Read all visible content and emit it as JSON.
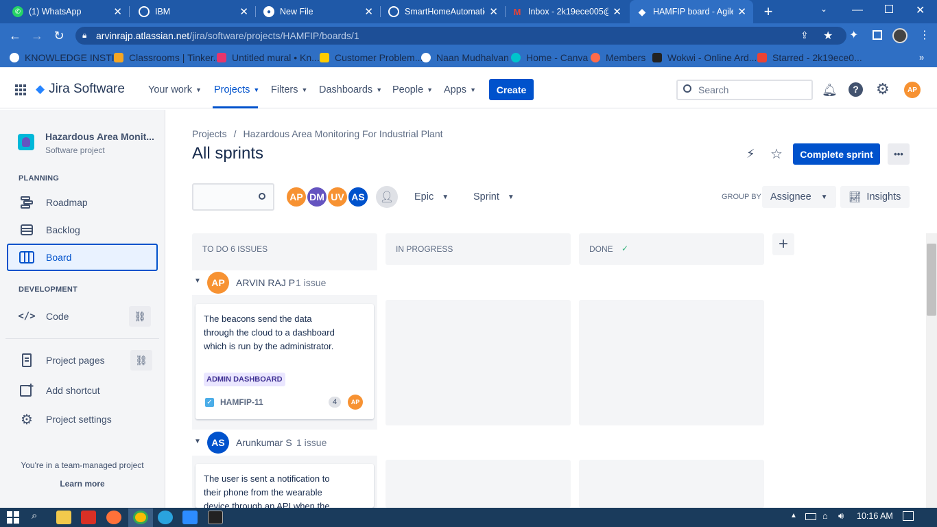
{
  "browser": {
    "tabs": [
      {
        "title": "(1) WhatsApp",
        "icon": "whatsapp-icon",
        "active": false
      },
      {
        "title": "IBM",
        "icon": "globe-icon",
        "active": false
      },
      {
        "title": "New File",
        "icon": "github-icon",
        "active": false
      },
      {
        "title": "SmartHomeAutomatic",
        "icon": "globe-icon",
        "active": false
      },
      {
        "title": "Inbox - 2k19ece005@",
        "icon": "gmail-icon",
        "active": false
      },
      {
        "title": "HAMFIP board - Agile",
        "icon": "jira-icon",
        "active": true
      }
    ],
    "new_tab": "+",
    "url_host": "arvinrajp.atlassian.net",
    "url_path": "/jira/software/projects/HAMFIP/boards/1",
    "bookmarks": [
      {
        "label": "KNOWLEDGE INSTI...",
        "color": "#ffffff"
      },
      {
        "label": "Classrooms | Tinker...",
        "color": "#f5a623"
      },
      {
        "label": "Untitled mural • Kn...",
        "color": "#e8356c"
      },
      {
        "label": "Customer Problem...",
        "color": "#ffcc00"
      },
      {
        "label": "Naan Mudhalvan",
        "color": "#ffffff"
      },
      {
        "label": "Home - Canva",
        "color": "#00c4cc"
      },
      {
        "label": "Members",
        "color": "#ff6b4a"
      },
      {
        "label": "Wokwi - Online Ard...",
        "color": "#222222"
      },
      {
        "label": "Starred - 2k19ece0...",
        "color": "#ea4335"
      }
    ]
  },
  "header": {
    "product": "Jira Software",
    "nav": [
      {
        "label": "Your work",
        "selected": false
      },
      {
        "label": "Projects",
        "selected": true
      },
      {
        "label": "Filters",
        "selected": false
      },
      {
        "label": "Dashboards",
        "selected": false
      },
      {
        "label": "People",
        "selected": false
      },
      {
        "label": "Apps",
        "selected": false
      }
    ],
    "create_label": "Create",
    "search_placeholder": "Search",
    "user_initials": "AP"
  },
  "sidebar": {
    "project_name": "Hazardous Area Monit...",
    "project_type": "Software project",
    "planning_label": "PLANNING",
    "planning_items": [
      {
        "label": "Roadmap",
        "icon": "roadmap-icon"
      },
      {
        "label": "Backlog",
        "icon": "backlog-icon"
      },
      {
        "label": "Board",
        "icon": "board-icon",
        "selected": true
      }
    ],
    "development_label": "DEVELOPMENT",
    "code_label": "Code",
    "project_pages_label": "Project pages",
    "add_shortcut_label": "Add shortcut",
    "project_settings_label": "Project settings",
    "team_managed_note": "You're in a team-managed project",
    "learn_more": "Learn more"
  },
  "main": {
    "breadcrumb_projects": "Projects",
    "breadcrumb_sep": "/",
    "breadcrumb_project": "Hazardous Area Monitoring For Industrial Plant",
    "title": "All sprints",
    "complete_sprint": "Complete sprint",
    "more": "•••",
    "filter_avatars": [
      {
        "initials": "AP",
        "color": "#f79232"
      },
      {
        "initials": "DM",
        "color": "#6554c0"
      },
      {
        "initials": "UV",
        "color": "#f79232"
      },
      {
        "initials": "AS",
        "color": "#0052cc"
      }
    ],
    "epic_label": "Epic",
    "sprint_label": "Sprint",
    "group_by_label": "GROUP BY",
    "group_by_value": "Assignee",
    "insights_label": "Insights",
    "columns": [
      {
        "title": "TO DO 6 ISSUES"
      },
      {
        "title": "IN PROGRESS"
      },
      {
        "title": "DONE"
      }
    ],
    "swimlanes": [
      {
        "initials": "AP",
        "color": "#f79232",
        "name": "ARVIN RAJ P",
        "count": "1 issue",
        "card": {
          "summary": "The beacons send the data through the cloud to a dashboard which is run by the administrator.",
          "epic": "ADMIN DASHBOARD",
          "key": "HAMFIP-11",
          "points": "4",
          "assignee": "AP"
        }
      },
      {
        "initials": "AS",
        "color": "#0052cc",
        "name": "Arunkumar S",
        "count": "1 issue",
        "card": {
          "summary": "The user is sent a notification to their phone from the wearable device through an API when the"
        }
      }
    ]
  },
  "taskbar": {
    "time": "10:16 AM"
  }
}
